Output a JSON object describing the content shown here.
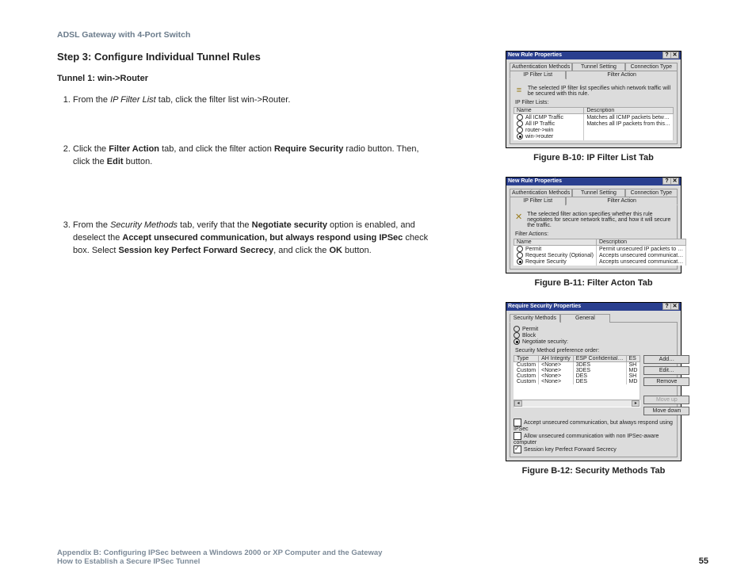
{
  "header": "ADSL Gateway with 4-Port Switch",
  "step_title": "Step 3: Configure Individual Tunnel Rules",
  "tunnel_title": "Tunnel 1: win->Router",
  "list": {
    "it1": {
      "pre": "From the ",
      "em": "IP Filter List",
      "post": " tab, click the filter list win->Router."
    },
    "it2": {
      "t1": "Click the ",
      "b1": "Filter Action",
      "t2": " tab, and click the filter action ",
      "b2": "Require Security",
      "t3": " radio button. Then, click the ",
      "b3": "Edit",
      "t4": " button."
    },
    "it3": {
      "t1": "From the ",
      "em": "Security Methods",
      "t2": " tab, verify that the ",
      "b1": "Negotiate security",
      "t3": " option is enabled, and deselect the ",
      "b2": "Accept unsecured communication, but always respond using IPSec",
      "t4": " check box. Select ",
      "b3": "Session key Perfect Forward Secrecy",
      "t5": ", and click the ",
      "b4": "OK",
      "t6": " button."
    }
  },
  "fig10": {
    "cap": "Figure B-10: IP Filter List Tab",
    "title": "New Rule Properties",
    "tabs": {
      "r1": [
        "Authentication Methods",
        "Tunnel Setting",
        "Connection Type"
      ],
      "r2": [
        "IP Filter List",
        "Filter Action"
      ]
    },
    "msg": "The selected IP filter list specifies which network traffic will be secured with this rule.",
    "group": "IP Filter Lists:",
    "cols": [
      "Name",
      "Description"
    ],
    "rows": [
      {
        "sel": false,
        "name": "All ICMP Traffic",
        "desc": "Matches all ICMP packets betw…"
      },
      {
        "sel": false,
        "name": "All IP Traffic",
        "desc": "Matches all IP packets from this…"
      },
      {
        "sel": false,
        "name": "router->win",
        "desc": ""
      },
      {
        "sel": true,
        "name": "win->router",
        "desc": ""
      }
    ]
  },
  "fig11": {
    "cap": "Figure B-11: Filter Acton Tab",
    "title": "New Rule Properties",
    "tabs": {
      "r1": [
        "Authentication Methods",
        "Tunnel Setting",
        "Connection Type"
      ],
      "r2": [
        "IP Filter List",
        "Filter Action"
      ]
    },
    "msg": "The selected filter action specifies whether this rule negotiates for secure network traffic, and how it will secure the traffic.",
    "group": "Filter Actions:",
    "cols": [
      "Name",
      "Description"
    ],
    "rows": [
      {
        "sel": false,
        "name": "Permit",
        "desc": "Permit unsecured IP packets to …"
      },
      {
        "sel": false,
        "name": "Request Security (Optional)",
        "desc": "Accepts unsecured communicat…"
      },
      {
        "sel": true,
        "name": "Require Security",
        "desc": "Accepts unsecured communicat…"
      }
    ]
  },
  "fig12": {
    "cap": "Figure B-12: Security Methods Tab",
    "title": "Require Security Properties",
    "tabs": [
      "Security Methods",
      "General"
    ],
    "radios": {
      "permit": "Permit",
      "block": "Block",
      "neg": "Negotiate security:"
    },
    "pref": "Security Method preference order:",
    "cols": [
      "Type",
      "AH Integrity",
      "ESP Confidential…",
      "ES"
    ],
    "rows": [
      [
        "Custom",
        "<None>",
        "3DES",
        "SH"
      ],
      [
        "Custom",
        "<None>",
        "3DES",
        "MD"
      ],
      [
        "Custom",
        "<None>",
        "DES",
        "SH"
      ],
      [
        "Custom",
        "<None>",
        "DES",
        "MD"
      ]
    ],
    "buttons": {
      "add": "Add…",
      "edit": "Edit…",
      "remove": "Remove",
      "moveup": "Move up",
      "movedown": "Move down"
    },
    "checks": {
      "c1": "Accept unsecured communication, but always respond using IPSec",
      "c2": "Allow unsecured communication with non IPSec-aware computer",
      "c3": "Session key Perfect Forward Secrecy"
    }
  },
  "footer": {
    "l1": "Appendix B: Configuring IPSec between a Windows 2000 or XP Computer and the Gateway",
    "l2": "How to Establish a Secure IPSec Tunnel",
    "page": "55"
  }
}
